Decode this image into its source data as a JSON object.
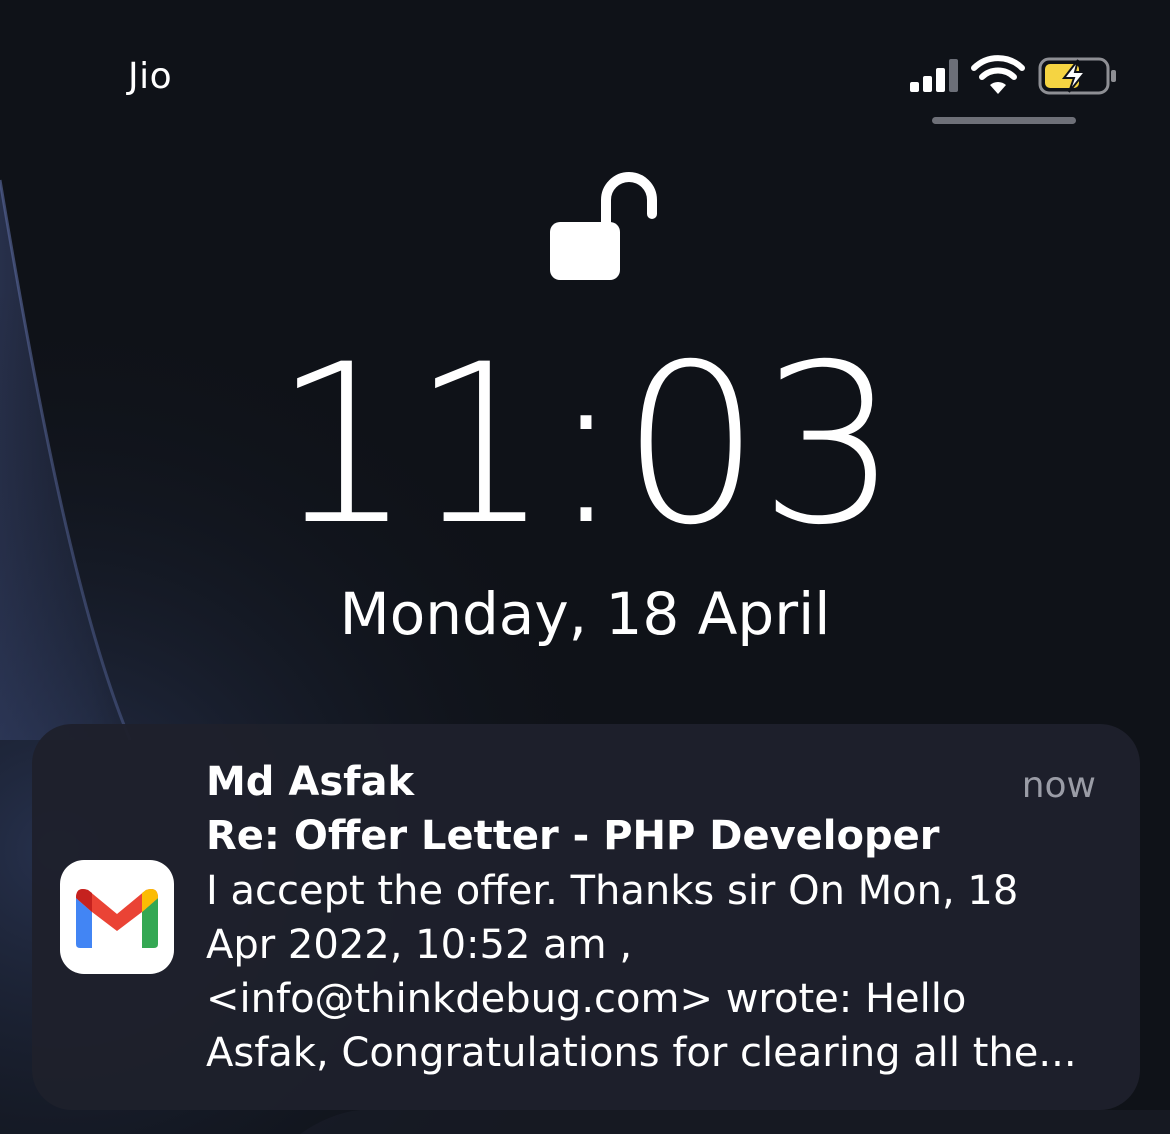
{
  "status_bar": {
    "carrier": "Jio",
    "signal_icon": "cellular-signal-icon",
    "wifi_icon": "wifi-icon",
    "battery_icon": "charging-battery-icon",
    "battery_color": "#f5d442"
  },
  "lock_screen": {
    "lock_icon": "unlocked-padlock-icon",
    "time": "11:03",
    "date": "Monday, 18 April"
  },
  "notification": {
    "app_icon": "gmail-icon",
    "sender": "Md Asfak",
    "time": "now",
    "subject": "Re: Offer Letter - PHP Developer",
    "body_lines": [
      "I accept the offer. Thanks sir On Mon, 18",
      "Apr 2022, 10:52 am ,",
      "<info@thinkdebug.com> wrote: Hello",
      "Asfak, Congratulations for clearing all the..."
    ]
  }
}
